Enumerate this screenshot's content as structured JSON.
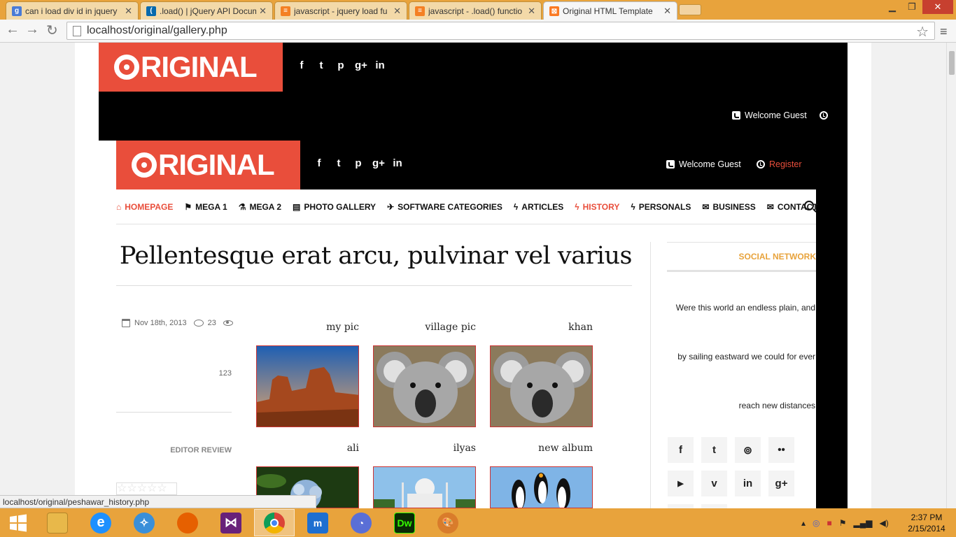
{
  "browser": {
    "tabs": [
      {
        "title": "can i load div id in jquery",
        "favicon": "google-icon",
        "color": "#4a7bd6"
      },
      {
        "title": ".load() | jQuery API Docum",
        "favicon": "jquery-icon",
        "color": "#0769ad"
      },
      {
        "title": "javascript - jquery load fu",
        "favicon": "stackoverflow-icon",
        "color": "#f48024"
      },
      {
        "title": "javascript - .load() functio",
        "favicon": "stackoverflow-icon",
        "color": "#f48024"
      },
      {
        "title": "Original HTML Template",
        "favicon": "xampp-icon",
        "color": "#fb7a24",
        "active": true
      }
    ],
    "url": "localhost/original/gallery.php",
    "status_url": "localhost/original/peshawar_history.php"
  },
  "site": {
    "logo_text": "RIGINAL",
    "social": [
      "f",
      "t",
      "p",
      "g+",
      "in"
    ],
    "welcome": "Welcome Guest",
    "register": "Register",
    "accent": "#e94e3b"
  },
  "nav": [
    {
      "label": "HOMEPAGE",
      "icon": "home-icon",
      "glyph": "⌂",
      "active": true
    },
    {
      "label": "MEGA 1",
      "icon": "flag-icon",
      "glyph": "⚑"
    },
    {
      "label": "MEGA 2",
      "icon": "flask-icon",
      "glyph": "⚗"
    },
    {
      "label": "PHOTO GALLERY",
      "icon": "file-icon",
      "glyph": "▤"
    },
    {
      "label": "SOFTWARE CATEGORIES",
      "icon": "plane-icon",
      "glyph": "✈"
    },
    {
      "label": "ARTICLES",
      "icon": "bolt-icon",
      "glyph": "ϟ"
    },
    {
      "label": "HISTORY",
      "icon": "bolt-icon",
      "glyph": "ϟ",
      "highlight": true
    },
    {
      "label": "PERSONALS",
      "icon": "bolt-icon",
      "glyph": "ϟ"
    },
    {
      "label": "BUSINESS",
      "icon": "envelope-icon",
      "glyph": "✉"
    },
    {
      "label": "CONTACT",
      "icon": "envelope-icon",
      "glyph": "✉"
    }
  ],
  "post": {
    "title": "Pellentesque erat arcu, pulvinar vel varius",
    "date": "Nov 18th, 2013",
    "comments": "23",
    "views": "123",
    "editor_review": "EDITOR REVIEW"
  },
  "gallery": [
    {
      "label": "my pic",
      "image": "desert-photo"
    },
    {
      "label": "village pic",
      "image": "koala-photo"
    },
    {
      "label": "khan",
      "image": "koala-photo"
    },
    {
      "label": "ali",
      "image": "hydrangea-photo"
    },
    {
      "label": "ilyas",
      "image": "taj-mahal-photo"
    },
    {
      "label": "new album",
      "image": "penguins-photo"
    }
  ],
  "sidebar": {
    "title": "SOCIAL NETWORK",
    "lines": [
      "Were this world an endless plain, and",
      "by sailing eastward we could for ever",
      "reach new distances"
    ],
    "social_buttons": [
      {
        "icon": "facebook-icon",
        "glyph": "f"
      },
      {
        "icon": "twitter-icon",
        "glyph": "t"
      },
      {
        "icon": "rss-icon",
        "glyph": "⊚"
      },
      {
        "icon": "flickr-icon",
        "glyph": "••"
      },
      {
        "icon": "youtube-icon",
        "glyph": "▶"
      },
      {
        "icon": "vimeo-icon",
        "glyph": "v"
      },
      {
        "icon": "linkedin-icon",
        "glyph": "in"
      },
      {
        "icon": "googleplus-icon",
        "glyph": "g+"
      }
    ]
  },
  "taskbar": {
    "time": "2:37 PM",
    "date": "2/15/2014",
    "apps": [
      {
        "name": "explorer-icon",
        "color": "#e8b84a"
      },
      {
        "name": "internet-explorer-icon",
        "color": "#1e90ff"
      },
      {
        "name": "safari-icon",
        "color": "#3a8fd9"
      },
      {
        "name": "firefox-icon",
        "color": "#e66000"
      },
      {
        "name": "visual-studio-icon",
        "color": "#68217a"
      },
      {
        "name": "chrome-icon",
        "color": "#db4437",
        "active": true
      },
      {
        "name": "maxthon-icon",
        "color": "#1e6fd0"
      },
      {
        "name": "torrent-icon",
        "color": "#5a6fd6"
      },
      {
        "name": "dreamweaver-icon",
        "color": "#35fa00",
        "text": "Dw"
      },
      {
        "name": "paint-icon",
        "color": "#d97c2b"
      }
    ]
  }
}
